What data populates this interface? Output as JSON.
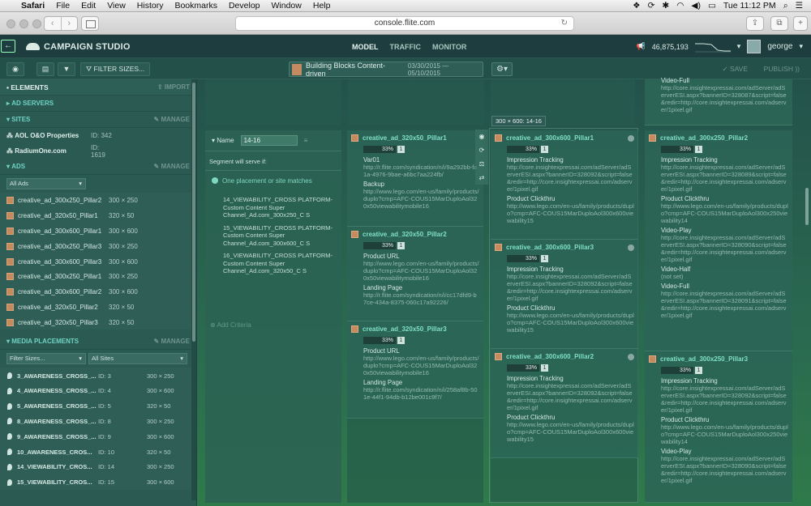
{
  "menubar": {
    "apple": "",
    "app": "Safari",
    "items": [
      "File",
      "Edit",
      "View",
      "History",
      "Bookmarks",
      "Develop",
      "Window",
      "Help"
    ],
    "clock": "Tue 11:12 PM"
  },
  "browser": {
    "url": "console.flite.com"
  },
  "header": {
    "logo": "CAMPAIGN STUDIO",
    "tabs": [
      "MODEL",
      "TRAFFIC",
      "MONITOR"
    ],
    "count": "46,875,193",
    "user": "george"
  },
  "subbar": {
    "filter_label": "FILTER SIZES...",
    "campaign_name": "Building Blocks Content-driven",
    "campaign_dates": "03/30/2015 — 05/10/2015",
    "save": "SAVE",
    "publish": "PUBLISH"
  },
  "left": {
    "elements": "ELEMENTS",
    "import": "IMPORT",
    "ad_servers": "AD SERVERS",
    "sites": "SITES",
    "manage": "MANAGE",
    "site_rows": [
      {
        "name": "AOL O&O Properties",
        "id": "ID: 342"
      },
      {
        "name": "RadiumOne.com",
        "id": "ID: 1619"
      }
    ],
    "ads": "ADS",
    "ads_filter": "All Ads",
    "ad_rows": [
      {
        "name": "creative_ad_300x250_Pillar2",
        "size": "300 × 250"
      },
      {
        "name": "creative_ad_320x50_Pillar1",
        "size": "320 × 50"
      },
      {
        "name": "creative_ad_300x600_Pillar1",
        "size": "300 × 600"
      },
      {
        "name": "creative_ad_300x250_Pillar3",
        "size": "300 × 250"
      },
      {
        "name": "creative_ad_300x600_Pillar3",
        "size": "300 × 600"
      },
      {
        "name": "creative_ad_300x250_Pillar1",
        "size": "300 × 250"
      },
      {
        "name": "creative_ad_300x600_Pillar2",
        "size": "300 × 600"
      },
      {
        "name": "creative_ad_320x50_Pillar2",
        "size": "320 × 50"
      },
      {
        "name": "creative_ad_320x50_Pillar3",
        "size": "320 × 50"
      }
    ],
    "media_placements": "MEDIA PLACEMENTS",
    "filter_sizes": "Filter Sizes...",
    "all_sites": "All Sites",
    "placement_rows": [
      {
        "name": "3_AWARENESS_CROSS_...",
        "id": "ID: 3",
        "size": "300 × 250"
      },
      {
        "name": "4_AWARENESS_CROSS_...",
        "id": "ID: 4",
        "size": "300 × 600"
      },
      {
        "name": "5_AWARENESS_CROSS_...",
        "id": "ID: 5",
        "size": "320 × 50"
      },
      {
        "name": "8_AWARENESS_CROSS_...",
        "id": "ID: 8",
        "size": "300 × 250"
      },
      {
        "name": "9_AWARENESS_CROSS_...",
        "id": "ID: 9",
        "size": "300 × 600"
      },
      {
        "name": "10_AWARENESS_CROS...",
        "id": "ID: 10",
        "size": "320 × 50"
      },
      {
        "name": "14_VIEWABILITY_CROS...",
        "id": "ID: 14",
        "size": "300 × 250"
      },
      {
        "name": "15_VIEWABILITY_CROS...",
        "id": "ID: 15",
        "size": "300 × 600"
      }
    ]
  },
  "segment": {
    "name_label": "Name",
    "name_value": "14-16",
    "will_serve": "Segment will serve if:",
    "match": "One placement or site matches",
    "placements": [
      "14_VIEWABILITY_CROSS PLATFORM-Custom Content Super Channel_Ad.com_300x250_C S",
      "15_VIEWABILITY_CROSS PLATFORM-Custom Content Super Channel_Ad.com_300x600_C S",
      "16_VIEWABILITY_CROSS PLATFORM-Custom Content Super Channel_Ad.com_320x50_C S"
    ],
    "add_criteria": "Add Criteria"
  },
  "tooltip": "300 × 600: 14-16",
  "cards": [
    {
      "title": "creative_ad_320x50_Pillar1",
      "pct": "33%",
      "n": "1",
      "fields": [
        {
          "label": "Var01",
          "value": "http://r.flite.com/syndication/n/i/9a292bb-fa1a-4976-9bae-a6bc7aa224fb/"
        },
        {
          "label": "Backup",
          "value": "http://www.lego.com/en-us/family/products/duplo?cmp=AFC-COUS15MarDuploAol320x50viewabilitymobile16"
        }
      ]
    },
    {
      "title": "creative_ad_320x50_Pillar2",
      "pct": "33%",
      "n": "1",
      "fields": [
        {
          "label": "Product URL",
          "value": "http://www.lego.com/en-us/family/products/duplo?cmp=AFC-COUS15MarDuploAol320x50viewabilitymobile16"
        },
        {
          "label": "Landing Page",
          "value": "http://r.flite.com/syndication/n/i/cc17dfd9-b7ce-434a-8375-060c17a92226/"
        }
      ]
    },
    {
      "title": "creative_ad_320x50_Pillar3",
      "pct": "33%",
      "n": "1",
      "fields": [
        {
          "label": "Product URL",
          "value": "http://www.lego.com/en-us/family/products/duplo?cmp=AFC-COUS15MarDuploAol320x50viewabilitymobile16"
        },
        {
          "label": "Landing Page",
          "value": "http://r.flite.com/syndication/n/i/258af8b-501e-44f1-94db-b12be001c9f7/"
        }
      ]
    },
    {
      "title": "creative_ad_300x600_Pillar1",
      "pct": "33%",
      "n": "1",
      "fields": [
        {
          "label": "Impression Tracking",
          "value": "http://core.insightexpressai.com/adServer/adServerESI.aspx?bannerID=328092&script=false&redir=http://core.insightexpressai.com/adserver/1pixel.gif"
        },
        {
          "label": "Product Clickthru",
          "value": "http://www.lego.com/en-us/family/products/duplo?cmp=AFC-COUS15MarDuploAol300x600viewability15"
        }
      ]
    },
    {
      "title": "creative_ad_300x600_Pillar3",
      "pct": "33%",
      "n": "1",
      "fields": [
        {
          "label": "Impression Tracking",
          "value": "http://core.insightexpressai.com/adServer/adServerESI.aspx?bannerID=328092&script=false&redir=http://core.insightexpressai.com/adserver/1pixel.gif"
        },
        {
          "label": "Product Clickthru",
          "value": "http://www.lego.com/en-us/family/products/duplo?cmp=AFC-COUS15MarDuploAol300x600viewability15"
        }
      ]
    },
    {
      "title": "creative_ad_300x600_Pillar2",
      "pct": "33%",
      "n": "1",
      "fields": [
        {
          "label": "Impression Tracking",
          "value": "http://core.insightexpressai.com/adServer/adServerESI.aspx?bannerID=328092&script=false&redir=http://core.insightexpressai.com/adserver/1pixel.gif"
        },
        {
          "label": "Product Clickthru",
          "value": "http://www.lego.com/en-us/family/products/duplo?cmp=AFC-COUS15MarDuploAol300x600viewability15"
        }
      ]
    },
    {
      "title": "creative_ad_300x250_Pillar2",
      "pct": "33%",
      "n": "1",
      "fields": [
        {
          "label": "Impression Tracking",
          "value": "http://core.insightexpressai.com/adServer/adServerESI.aspx?bannerID=328089&script=false&redir=http://core.insightexpressai.com/adserver/1pixel.gif"
        },
        {
          "label": "Product Clickthru",
          "value": "http://www.lego.com/en-us/family/products/duplo?cmp=AFC-COUS15MarDuploAol300x250viewability14"
        },
        {
          "label": "Video-Play",
          "value": "http://core.insightexpressai.com/adServer/adServerESI.aspx?bannerID=328090&script=false&redir=http://core.insightexpressai.com/adserver/1pixel.gif"
        },
        {
          "label": "Video-Half",
          "value": "(not set)"
        },
        {
          "label": "Video-Full",
          "value": "http://core.insightexpressai.com/adServer/adServerESI.aspx?bannerID=328091&script=false&redir=http://core.insightexpressai.com/adserver/1pixel.gif"
        }
      ]
    },
    {
      "title": "creative_ad_300x250_Pillar3",
      "pct": "33%",
      "n": "1",
      "fields": [
        {
          "label": "Impression Tracking",
          "value": "http://core.insightexpressai.com/adServer/adServerESI.aspx?bannerID=328092&script=false&redir=http://core.insightexpressai.com/adserver/1pixel.gif"
        },
        {
          "label": "Product Clickthru",
          "value": "http://www.lego.com/en-us/family/products/duplo?cmp=AFC-COUS15MarDuploAol300x250viewability14"
        },
        {
          "label": "Video-Play",
          "value": "http://core.insightexpressai.com/adServer/adServerESI.aspx?bannerID=328090&script=false&redir=http://core.insightexpressai.com/adserver/1pixel.gif"
        }
      ]
    }
  ],
  "top_right_fragment": {
    "label": "Video-Full",
    "value": "http://core.insightexpressai.com/adServer/adServerESI.aspx?bannerID=328087&script=false&redir=http://core.insightexpressai.com/adserver/1pixel.gif"
  }
}
